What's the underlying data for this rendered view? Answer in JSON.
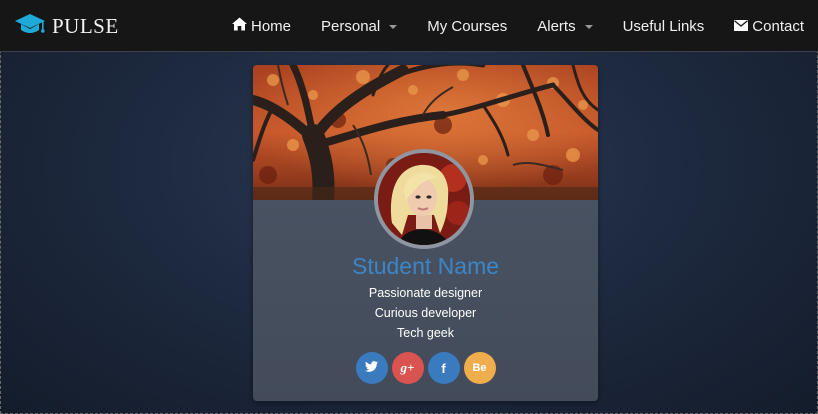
{
  "brand": {
    "name": "PULSE",
    "icon": "graduation-cap-icon",
    "accent": "#1fa9d6"
  },
  "nav": {
    "items": [
      {
        "label": "Home",
        "icon": "home-icon"
      },
      {
        "label": "Personal",
        "dropdown": true
      },
      {
        "label": "My Courses"
      },
      {
        "label": "Alerts",
        "dropdown": true
      },
      {
        "label": "Useful Links"
      },
      {
        "label": "Contact",
        "icon": "envelope-icon"
      }
    ]
  },
  "profile": {
    "name": "Student Name",
    "name_color": "#3c86c8",
    "bio": [
      "Passionate designer",
      "Curious developer",
      "Tech geek"
    ],
    "social": [
      {
        "service": "twitter",
        "glyph": "",
        "icon": "twitter-icon",
        "color": "#3a7bbf"
      },
      {
        "service": "google-plus",
        "glyph": "g+",
        "icon": "google-plus-icon",
        "color": "#d9534f"
      },
      {
        "service": "facebook",
        "glyph": "f",
        "icon": "facebook-icon",
        "color": "#3a7bbf"
      },
      {
        "service": "behance",
        "glyph": "Be",
        "icon": "behance-icon",
        "color": "#f0ad4e"
      }
    ]
  }
}
